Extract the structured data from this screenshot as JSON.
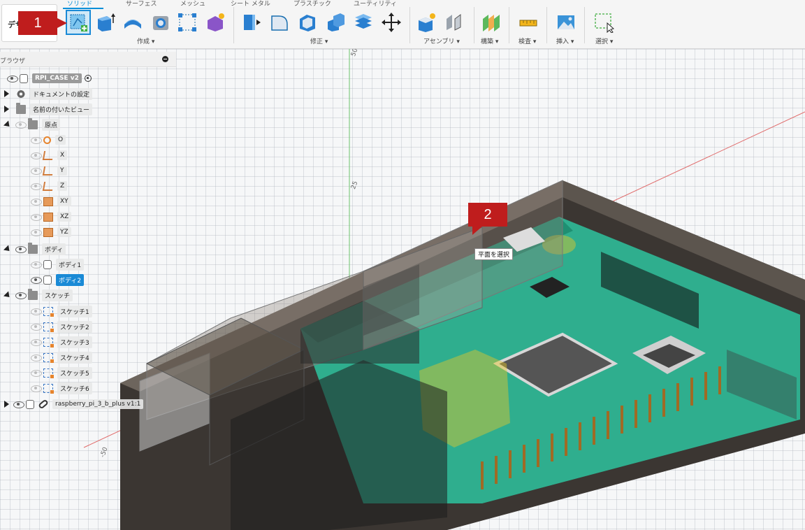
{
  "workspace": {
    "label": "デザ"
  },
  "tabs": [
    "ソリッド",
    "サーフェス",
    "メッシュ",
    "シート メタル",
    "プラスチック",
    "ユーティリティ"
  ],
  "toolbar_groups": {
    "create": "作成 ▾",
    "modify": "修正 ▾",
    "assemble": "アセンブリ ▾",
    "construct": "構築 ▾",
    "inspect": "検査 ▾",
    "insert": "挿入 ▾",
    "select": "選択 ▾"
  },
  "browser": {
    "title": "ブラウザ",
    "root": "RPI_CASE v2",
    "items": {
      "doc_settings": "ドキュメントの設定",
      "named_views": "名前の付いたビュー",
      "origin": "原点",
      "origin_o": "O",
      "origin_x": "X",
      "origin_y": "Y",
      "origin_z": "Z",
      "plane_xy": "XY",
      "plane_xz": "XZ",
      "plane_yz": "YZ",
      "bodies": "ボディ",
      "body1": "ボディ1",
      "body2": "ボディ2",
      "sketches": "スケッチ",
      "sketch1": "スケッチ1",
      "sketch2": "スケッチ2",
      "sketch3": "スケッチ3",
      "sketch4": "スケッチ4",
      "sketch5": "スケッチ5",
      "sketch6": "スケッチ6",
      "component": "raspberry_pi_3_b_plus v1:1"
    }
  },
  "callouts": {
    "one": "1",
    "two": "2"
  },
  "tooltip": "平面を選択",
  "axis_labels": {
    "top": "50",
    "middle": "25",
    "left": "-50"
  },
  "colors": {
    "accent": "#0b8fd8",
    "callout": "#bf1d1d",
    "pcb": "#2fae8e",
    "case": "#8a8178"
  }
}
